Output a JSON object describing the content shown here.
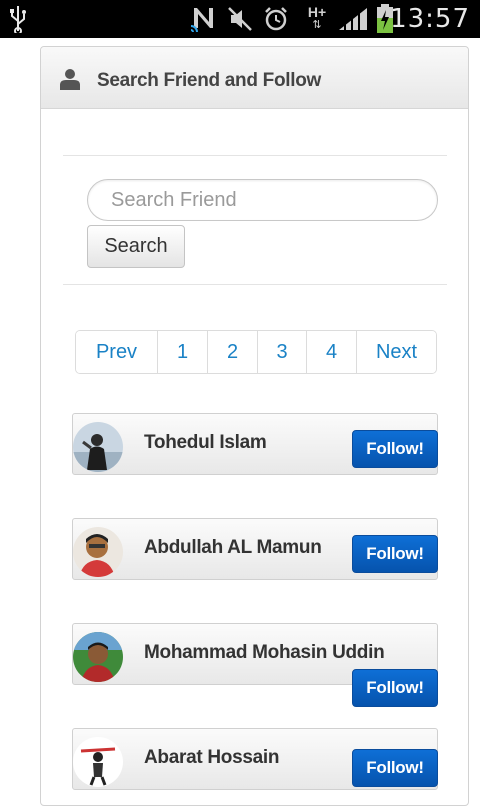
{
  "status_bar": {
    "time": "13:57",
    "icons": [
      "usb-icon",
      "nfc-icon",
      "mute-icon",
      "alarm-icon",
      "hplus-data-icon",
      "signal-icon",
      "battery-charging-icon"
    ],
    "network_label": "H+"
  },
  "panel": {
    "title": "Search Friend and Follow",
    "icon": "user-icon"
  },
  "search": {
    "placeholder": "Search Friend",
    "value": "",
    "button_label": "Search"
  },
  "pagination": {
    "items": [
      "Prev",
      "1",
      "2",
      "3",
      "4",
      "Next"
    ],
    "link_color": "#1a82c6"
  },
  "friends": [
    {
      "name": "Tohedul Islam",
      "button_label": "Follow!"
    },
    {
      "name": "Abdullah AL Mamun",
      "button_label": "Follow!"
    },
    {
      "name": "Mohammad Mohasin Uddin",
      "button_label": "Follow!"
    },
    {
      "name": "Abarat Hossain",
      "button_label": "Follow!"
    }
  ],
  "colors": {
    "accent": "#0a62c8",
    "link": "#1a82c6"
  }
}
